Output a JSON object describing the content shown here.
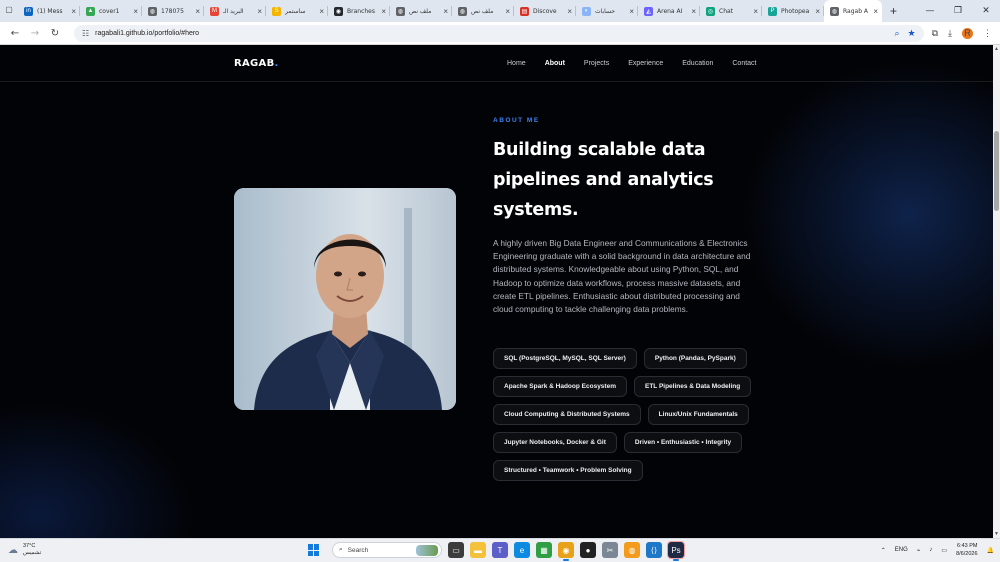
{
  "browser": {
    "tabs": [
      {
        "title": "(1) Mess",
        "color": "#0a66c2",
        "glyph": "in"
      },
      {
        "title": "cover1",
        "color": "#34a853",
        "glyph": "▲"
      },
      {
        "title": "178075",
        "color": "#5f6368",
        "glyph": "◍"
      },
      {
        "title": "البريد الـ",
        "color": "#ea4335",
        "glyph": "M"
      },
      {
        "title": "سأستمر",
        "color": "#f4b400",
        "glyph": "S"
      },
      {
        "title": "Branches",
        "color": "#24292f",
        "glyph": "◉"
      },
      {
        "title": "ملف نص",
        "color": "#5f6368",
        "glyph": "◍"
      },
      {
        "title": "ملف نص",
        "color": "#5f6368",
        "glyph": "◍"
      },
      {
        "title": "Discove",
        "color": "#d93025",
        "glyph": "▤"
      },
      {
        "title": "حسابات",
        "color": "#8ab4f8",
        "glyph": "◐"
      },
      {
        "title": "Arena AI",
        "color": "#6c63ff",
        "glyph": "◭"
      },
      {
        "title": "Chat",
        "color": "#10a37f",
        "glyph": "◎"
      },
      {
        "title": "Photopea",
        "color": "#18a497",
        "glyph": "P"
      },
      {
        "title": "Ragab A",
        "color": "#5f6368",
        "glyph": "◍",
        "active": true
      }
    ],
    "new_tab_label": "+",
    "url": "ragabali1.github.io/portfolio/#hero",
    "profile_initial": "R"
  },
  "site": {
    "brand": "RAGAB",
    "brand_dot": ".",
    "nav": [
      {
        "label": "Home",
        "active": false
      },
      {
        "label": "About",
        "active": true
      },
      {
        "label": "Projects",
        "active": false
      },
      {
        "label": "Experience",
        "active": false
      },
      {
        "label": "Education",
        "active": false
      },
      {
        "label": "Contact",
        "active": false
      }
    ],
    "eyebrow": "ABOUT ME",
    "headline": "Building scalable data pipelines and analytics systems.",
    "bio": "A highly driven Big Data Engineer and Communications & Electronics Engineering graduate with a solid background in data architecture and distributed systems. Knowledgeable about using Python, SQL, and Hadoop to optimize data workflows, process massive datasets, and create ETL pipelines. Enthusiastic about distributed processing and cloud computing to tackle challenging data problems.",
    "skills": [
      "SQL (PostgreSQL, MySQL, SQL Server)",
      "Python (Pandas, PySpark)",
      "Apache Spark & Hadoop Ecosystem",
      "ETL Pipelines & Data Modeling",
      "Cloud Computing & Distributed Systems",
      "Linux/Unix Fundamentals",
      "Jupyter Notebooks, Docker & Git",
      "Driven • Enthusiastic • Integrity",
      "Structured • Teamwork • Problem Solving"
    ],
    "accent_color": "#3b82f6"
  },
  "taskbar": {
    "temperature": "37°C",
    "weather_text": "تشميس",
    "search_placeholder": "Search",
    "language": "ENG",
    "time": "6:43 PM",
    "date": "8/6/2026"
  }
}
